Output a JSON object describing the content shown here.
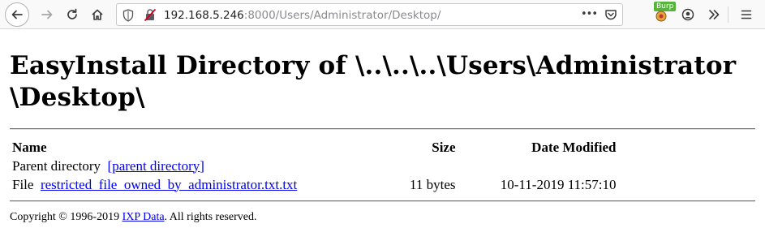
{
  "browser": {
    "url_host": "192.168.5.246",
    "url_path": ":8000/Users/Administrator/Desktop/",
    "burp_label": "Burp",
    "overflow_dots": "•••"
  },
  "page": {
    "title_line1": "EasyInstall Directory of \\..\\..\\..\\Users\\Administrator",
    "title_line2": "\\Desktop\\"
  },
  "table": {
    "headers": {
      "name": "Name",
      "size": "Size",
      "date": "Date Modified"
    },
    "rows": [
      {
        "type": "Parent directory",
        "link": "[parent directory]",
        "size": "",
        "date": ""
      },
      {
        "type": "File",
        "link": "restricted_file_owned_by_administrator.txt.txt",
        "size": "11 bytes",
        "date": "10-11-2019 11:57:10"
      }
    ]
  },
  "footer": {
    "prefix": "Copyright © 1996-2019 ",
    "link": "IXP Data",
    "suffix": ". All rights reserved."
  }
}
